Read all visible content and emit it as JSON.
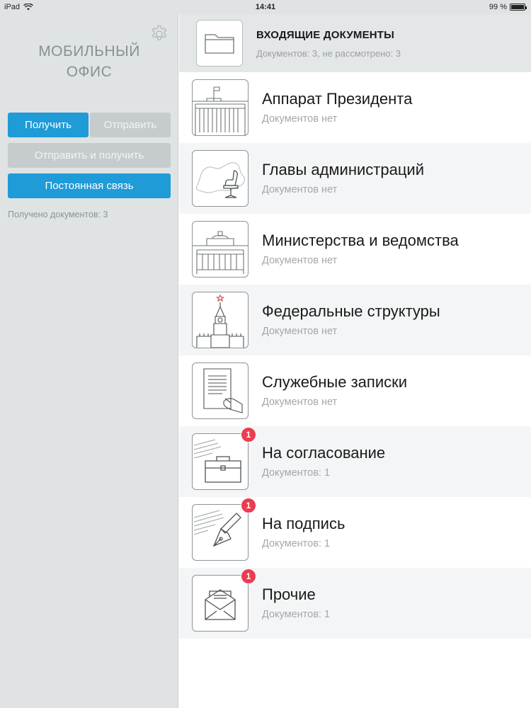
{
  "status_bar": {
    "device": "iPad",
    "time": "14:41",
    "battery": "99 %",
    "battery_level": 0.99
  },
  "sidebar": {
    "title_line1": "МОБИЛЬНЫЙ",
    "title_line2": "ОФИС",
    "buttons": {
      "receive": "Получить",
      "send": "Отправить",
      "send_receive": "Отправить и получить",
      "constant": "Постоянная связь"
    },
    "received_text": "Получено документов: 3"
  },
  "header": {
    "title": "ВХОДЯЩИЕ ДОКУМЕНТЫ",
    "subtitle": "Документов: 3, не рассмотрено: 3"
  },
  "folders": [
    {
      "title": "Аппарат Президента",
      "subtitle": "Документов нет",
      "icon": "presidential-building-icon",
      "badge": ""
    },
    {
      "title": "Главы администраций",
      "subtitle": "Документов нет",
      "icon": "map-chair-icon",
      "badge": ""
    },
    {
      "title": "Министерства и ведомства",
      "subtitle": "Документов нет",
      "icon": "ministry-building-icon",
      "badge": ""
    },
    {
      "title": "Федеральные структуры",
      "subtitle": "Документов нет",
      "icon": "kremlin-tower-icon",
      "badge": ""
    },
    {
      "title": "Служебные записки",
      "subtitle": "Документов нет",
      "icon": "memo-hand-icon",
      "badge": ""
    },
    {
      "title": "На согласование",
      "subtitle": "Документов: 1",
      "icon": "briefcase-icon",
      "badge": "1"
    },
    {
      "title": "На подпись",
      "subtitle": "Документов: 1",
      "icon": "fountain-pen-icon",
      "badge": "1"
    },
    {
      "title": "Прочие",
      "subtitle": "Документов: 1",
      "icon": "envelope-icon",
      "badge": "1"
    }
  ],
  "colors": {
    "accent": "#1f9bd8",
    "badge": "#ec3c4f",
    "sidebar_bg": "#dfe3e4"
  }
}
